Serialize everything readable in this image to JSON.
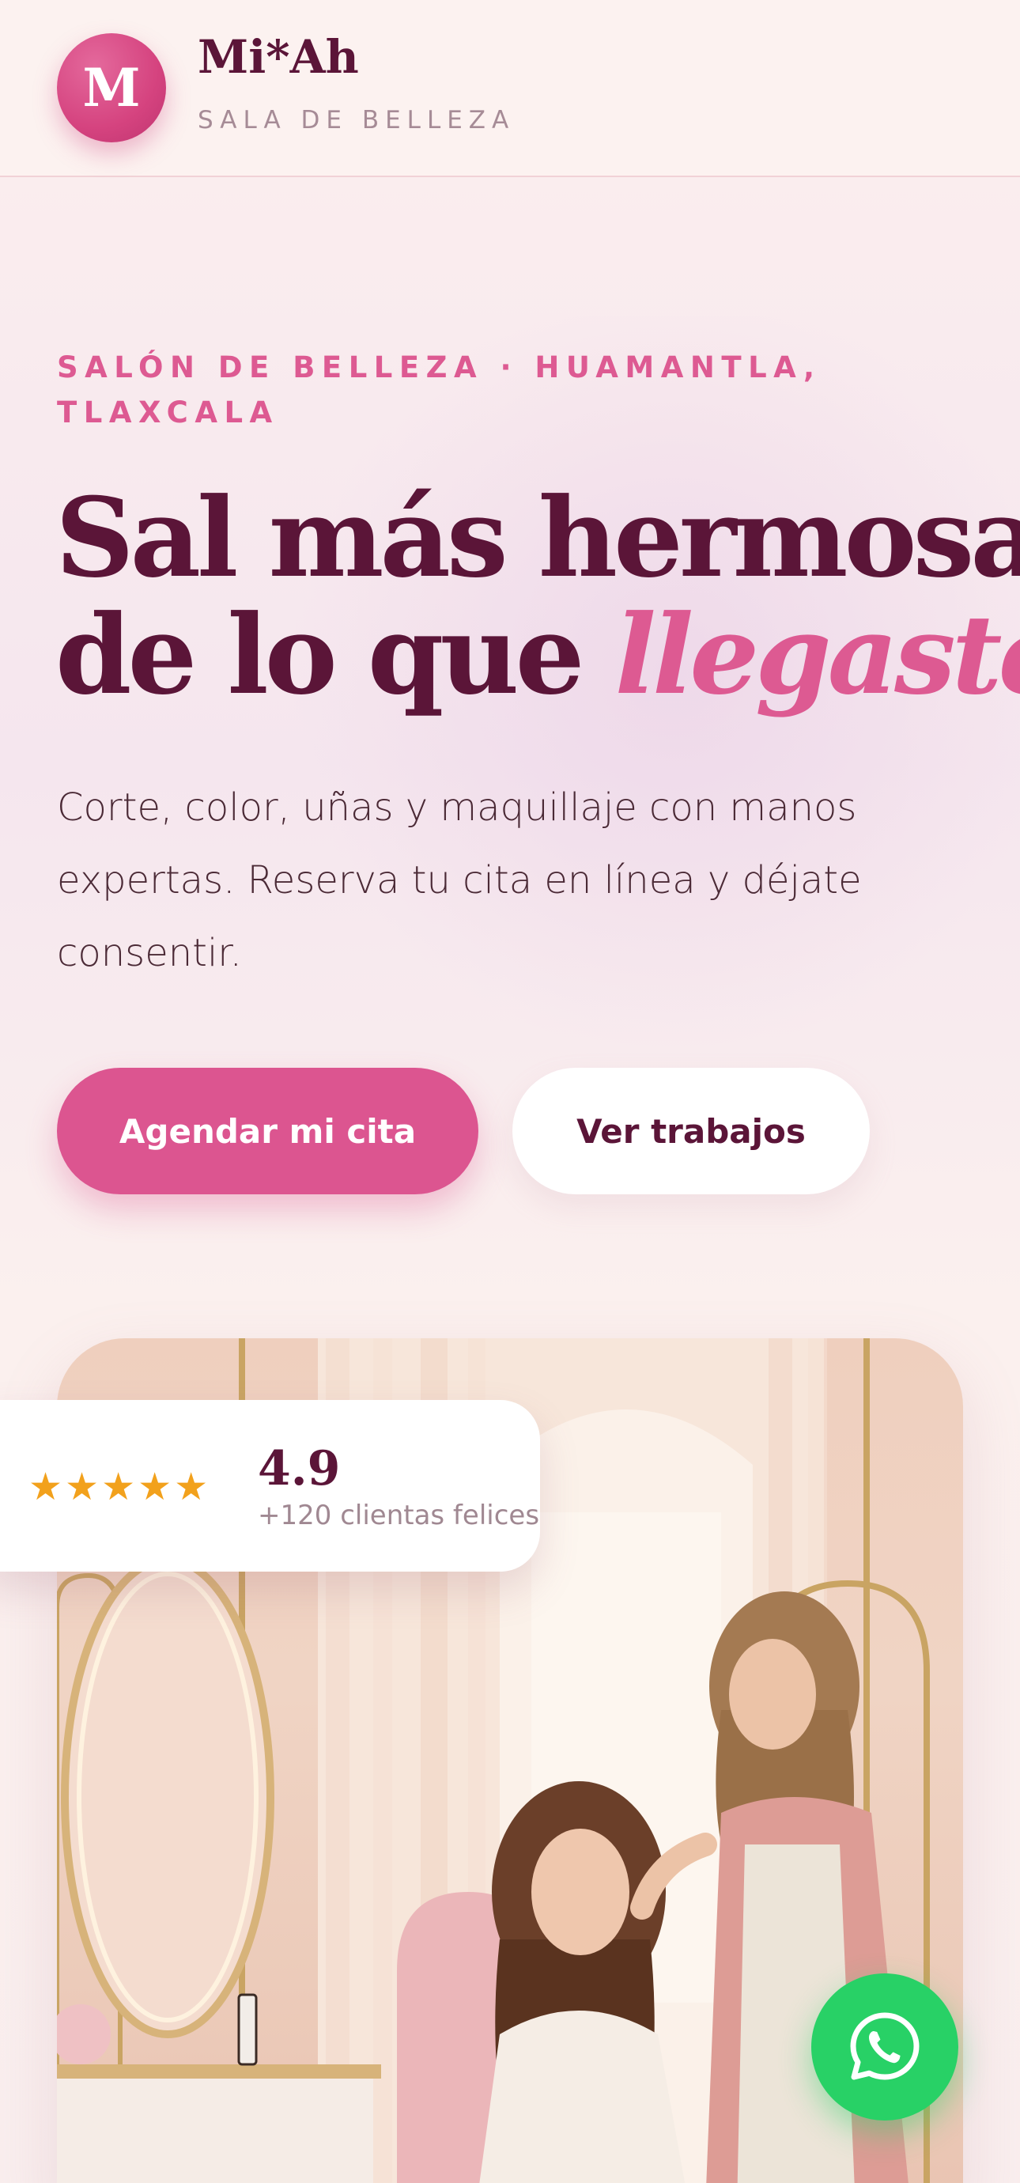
{
  "header": {
    "logo_letter": "M",
    "brand_name": "Mi*Ah",
    "brand_tagline": "SALA DE BELLEZA"
  },
  "hero": {
    "eyebrow": "SALÓN DE BELLEZA · HUAMANTLA, TLAXCALA",
    "headline_line1": "Sal más hermosa",
    "headline_line2_prefix": "de lo que ",
    "headline_accent": "llegaste.",
    "subtext": "Corte, color, uñas y maquillaje con manos expertas. Reserva tu cita en línea y déjate consentir.",
    "primary_cta": "Agendar mi cita",
    "secondary_cta": "Ver trabajos"
  },
  "rating": {
    "stars": "★★★★★",
    "stars_count": 5,
    "value": "4.9",
    "caption": "+120 clientas felices"
  },
  "floating": {
    "whatsapp_icon": "whatsapp-icon"
  },
  "colors": {
    "brand_dark": "#5b1538",
    "accent_pink": "#dd5a92",
    "star": "#f2a11c",
    "whatsapp": "#28d166"
  }
}
